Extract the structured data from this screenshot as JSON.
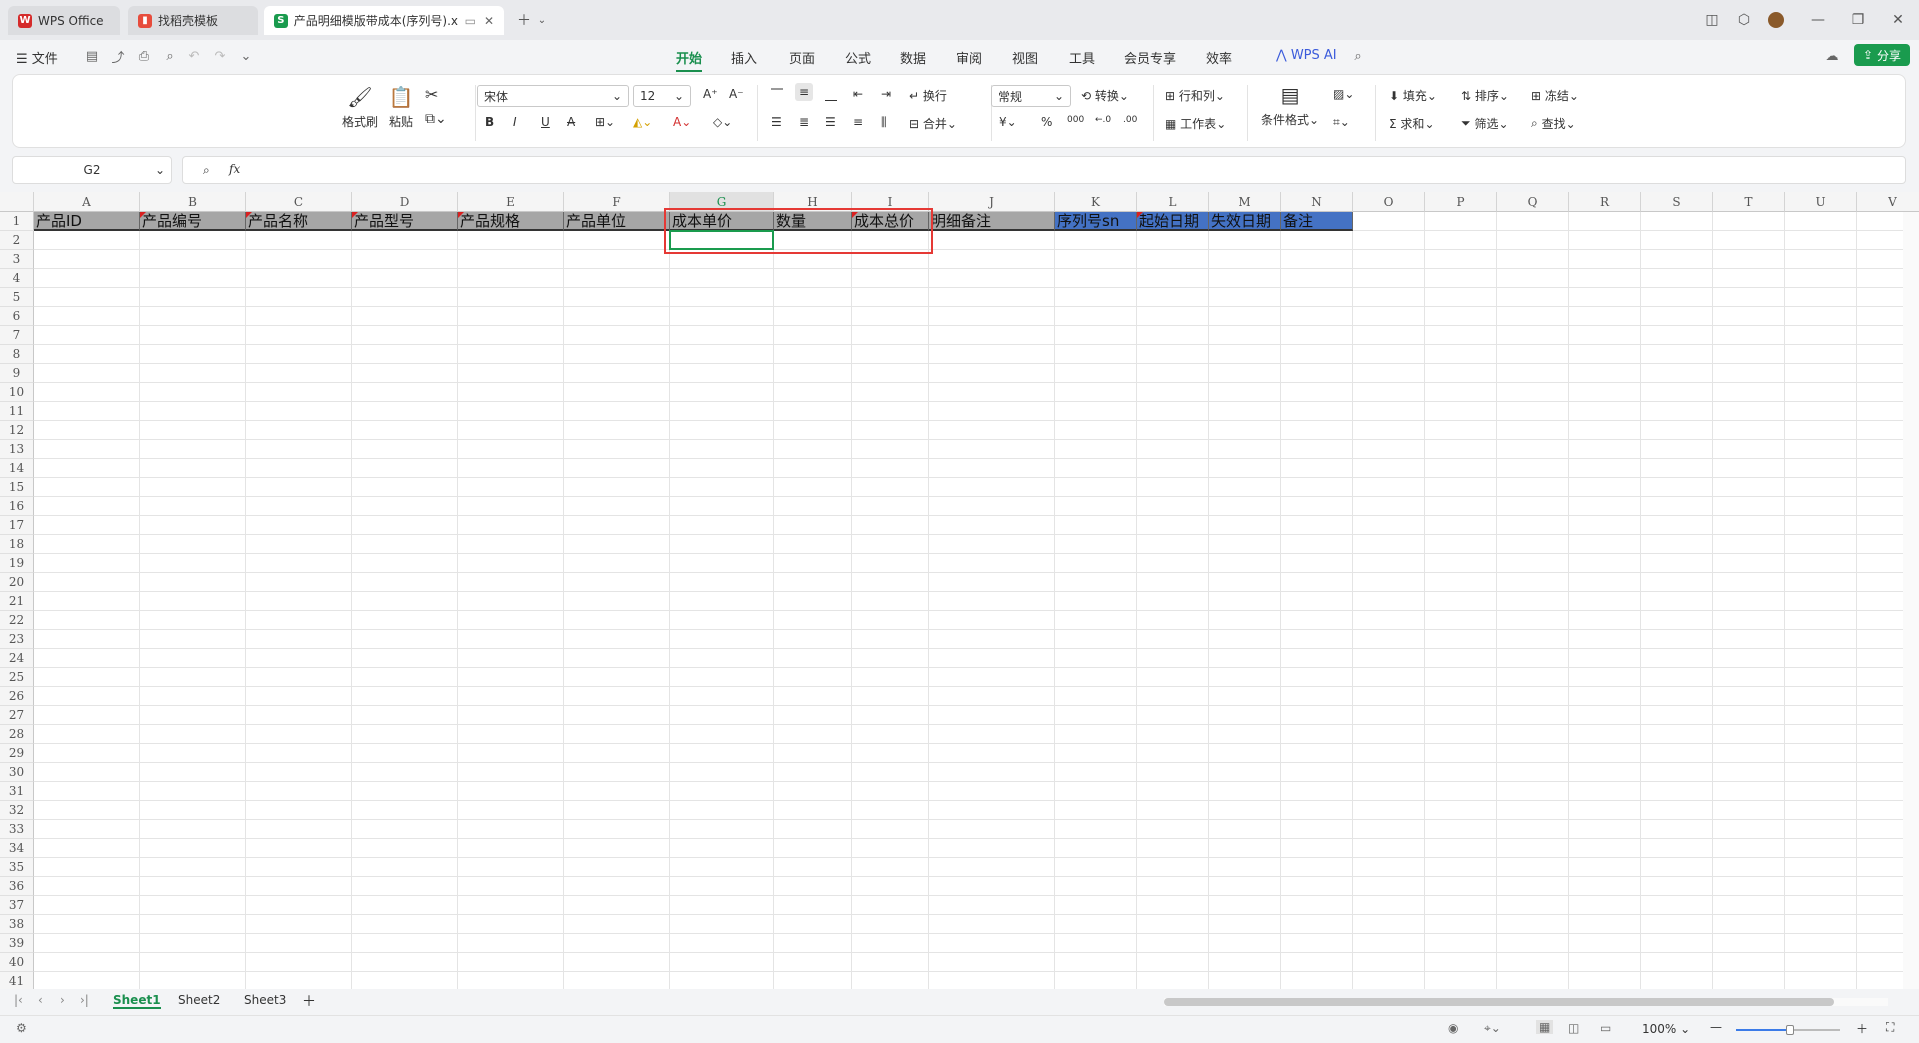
{
  "tabs": [
    {
      "label": "WPS Office",
      "icon": "wps-logo-icon"
    },
    {
      "label": "找稻壳模板",
      "icon": "docer-icon"
    },
    {
      "label": "产品明细模版带成本(序列号).x",
      "icon": "spreadsheet-icon"
    }
  ],
  "menu": {
    "file": "文件",
    "items": [
      "开始",
      "插入",
      "页面",
      "公式",
      "数据",
      "审阅",
      "视图",
      "工具",
      "会员专享",
      "效率"
    ],
    "active": "开始",
    "ai": "WPS AI",
    "share": "分享"
  },
  "ribbon": {
    "format_painter": "格式刷",
    "paste": "粘贴",
    "font_name": "宋体",
    "font_size": "12",
    "wrap": "换行",
    "merge": "合并",
    "number_format": "常规",
    "convert": "转换",
    "rows_cols": "行和列",
    "worksheet": "工作表",
    "cond_format": "条件格式",
    "fill": "填充",
    "sort": "排序",
    "freeze": "冻结",
    "sum": "求和",
    "filter": "筛选",
    "find": "查找"
  },
  "namebox": "G2",
  "fx": "fx",
  "columns": [
    "A",
    "B",
    "C",
    "D",
    "E",
    "F",
    "G",
    "H",
    "I",
    "J",
    "K",
    "L",
    "M",
    "N",
    "O",
    "P",
    "Q",
    "R",
    "S",
    "T",
    "U",
    "V"
  ],
  "selected_column": "G",
  "row_count": 41,
  "header_row": [
    "产品ID",
    "产品编号",
    "产品名称",
    "产品型号",
    "产品规格",
    "产品单位",
    "成本单价",
    "数量",
    "成本总价",
    "明细备注",
    "序列号sn",
    "起始日期",
    "失效日期",
    "备注"
  ],
  "sheets": [
    "Sheet1",
    "Sheet2",
    "Sheet3"
  ],
  "active_sheet": "Sheet1",
  "zoom": "100%",
  "colors": {
    "accent": "#1a8f4e",
    "header_gray": "#a6a6a6",
    "header_blue": "#4472c4",
    "highlight": "#e53935"
  }
}
